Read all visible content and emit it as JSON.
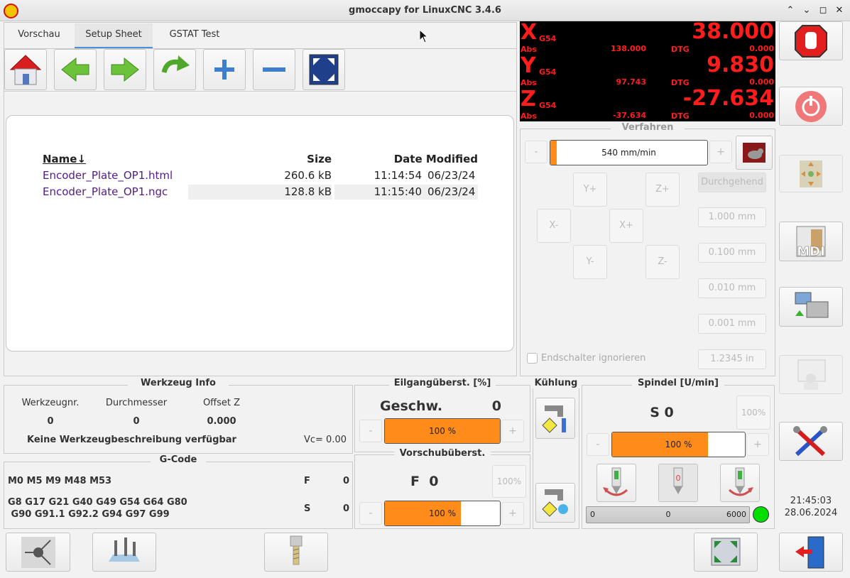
{
  "window": {
    "title": "gmoccapy for LinuxCNC  3.4.6",
    "buttons": [
      "⌃",
      "⌄",
      "◻",
      "✕"
    ]
  },
  "tabs": [
    {
      "label": "Vorschau"
    },
    {
      "label": "Setup Sheet"
    },
    {
      "label": "GSTAT Test"
    }
  ],
  "toolbar": {
    "home": "home-icon",
    "back": "arrow-left-icon",
    "forward": "arrow-right-icon",
    "refresh": "refresh-icon",
    "add": "plus-icon",
    "remove": "minus-icon",
    "fit": "fit-screen-icon"
  },
  "files": {
    "headers": {
      "name": "Name↓",
      "size": "Size",
      "date": "Date Modified"
    },
    "rows": [
      {
        "name": "Encoder_Plate_OP1.html",
        "size": "260.6 kB",
        "time": "11:14:54",
        "date": "06/23/24"
      },
      {
        "name": "Encoder_Plate_OP1.ngc",
        "size": "128.8 kB",
        "time": "11:15:40",
        "date": "06/23/24"
      }
    ]
  },
  "dro": [
    {
      "axis": "X",
      "cs": "G54",
      "value": "38.000",
      "abs_label": "Abs",
      "abs": "138.000",
      "dtg_label": "DTG",
      "dtg": "0.000"
    },
    {
      "axis": "Y",
      "cs": "G54",
      "value": "9.830",
      "abs_label": "Abs",
      "abs": "97.743",
      "dtg_label": "DTG",
      "dtg": "0.000"
    },
    {
      "axis": "Z",
      "cs": "G54",
      "value": "-27.634",
      "abs_label": "Abs",
      "abs": "-37.634",
      "dtg_label": "DTG",
      "dtg": "0.000"
    }
  ],
  "jog": {
    "title": "Verfahren",
    "minus": "-",
    "plus": "+",
    "speed": "540 mm/min",
    "speed_fraction": 0.04,
    "buttons": {
      "yplus": "Y+",
      "zplus": "Z+",
      "xminus": "X-",
      "xplus": "X+",
      "yminus": "Y-",
      "zminus": "Z-"
    },
    "increments": [
      "Durchgehend",
      "1.000 mm",
      "0.100 mm",
      "0.010 mm",
      "0.001 mm",
      "1.2345 in"
    ],
    "limits_label": "Endschalter ignorieren"
  },
  "tool": {
    "title": "Werkzeug Info",
    "number_label": "Werkzeugnr.",
    "diameter_label": "Durchmesser",
    "offset_label": "Offset Z",
    "number": "0",
    "diameter": "0",
    "offset": "0.000",
    "description": "Keine Werkzeugbeschreibung verfügbar",
    "vc": "Vc= 0.00"
  },
  "gcode": {
    "title": "G-Code",
    "m_codes": "M0 M5 M9 M48 M53",
    "g_line1": "G8 G17 G21 G40 G49 G54 G64 G80",
    "g_line2": " G90 G91.1 G92.2 G94 G97 G99",
    "f_label": "F",
    "f_value": "0",
    "s_label": "S",
    "s_value": "0"
  },
  "rapid": {
    "title": "Eilgangüberst. [%]",
    "label": "Geschw.",
    "value": "0",
    "slider": "100 %",
    "fraction": 1.0
  },
  "feed": {
    "title": "Vorschubüberst.",
    "label": "F  0",
    "reset": "100%",
    "slider": "100 %",
    "fraction": 0.66
  },
  "coolant": {
    "title": "Kühlung"
  },
  "spindle": {
    "title": "Spindel [U/min]",
    "speed": "S 0",
    "reset": "100%",
    "slider": "100 %",
    "fraction": 0.72,
    "bar_min": "0",
    "bar_value": "0",
    "bar_max": "6000",
    "status_color": "#00dd00"
  },
  "clock": {
    "time": "21:45:03",
    "date": "28.06.2024"
  },
  "colors": {
    "accent": "#ff8c1a",
    "dro": "#ff1c1c",
    "link": "#551a8b"
  }
}
